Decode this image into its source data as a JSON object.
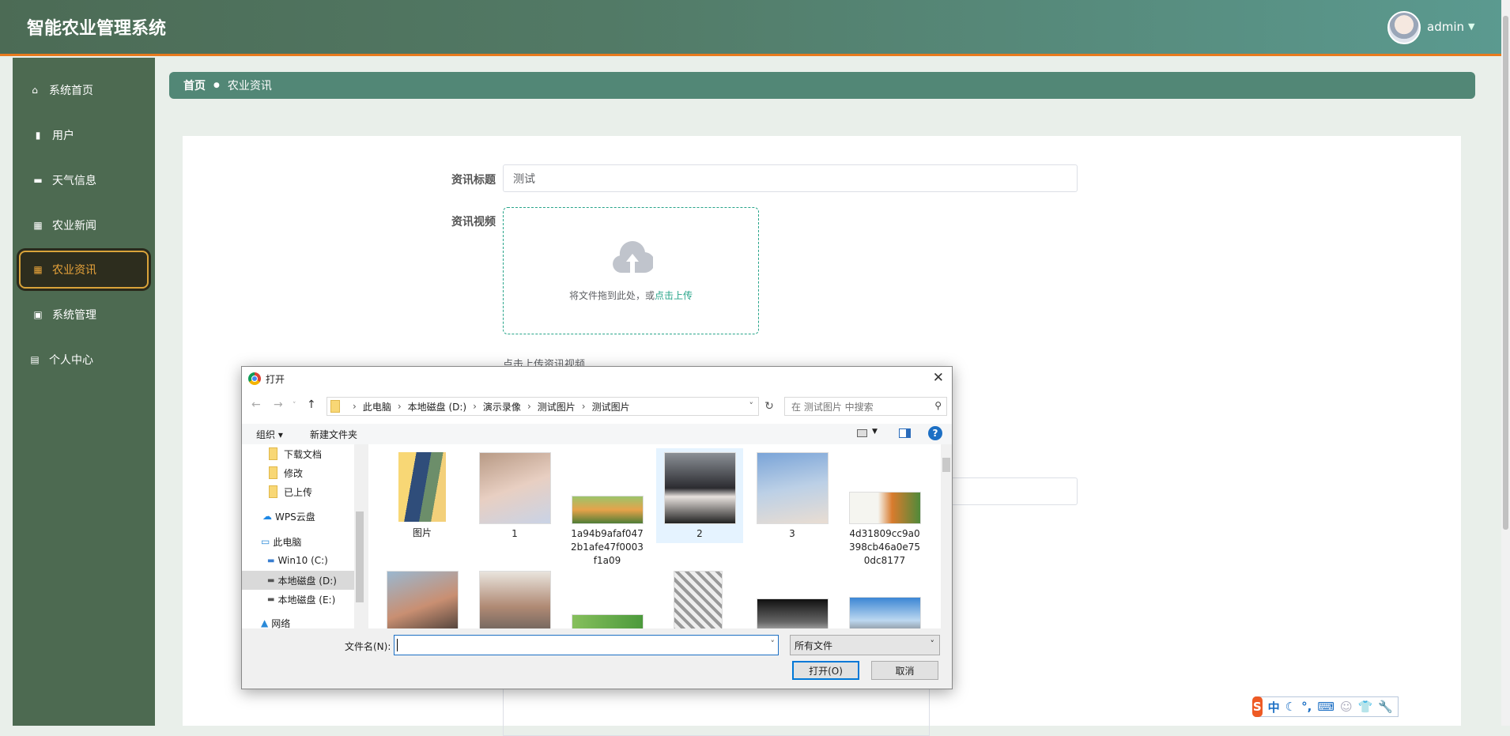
{
  "header": {
    "title": "智能农业管理系统",
    "user": "admin"
  },
  "sidebar": {
    "items": [
      {
        "label": "系统首页",
        "icon": "home-icon",
        "glyph": "⌂"
      },
      {
        "label": "用户",
        "icon": "bar-chart-icon",
        "glyph": "▮"
      },
      {
        "label": "天气信息",
        "icon": "ticket-icon",
        "glyph": "▬"
      },
      {
        "label": "农业新闻",
        "icon": "grid-icon",
        "glyph": "▦"
      },
      {
        "label": "农业资讯",
        "icon": "grid-icon",
        "glyph": "▦",
        "active": true
      },
      {
        "label": "系统管理",
        "icon": "clipboard-icon",
        "glyph": "▣"
      },
      {
        "label": "个人中心",
        "icon": "calendar-icon",
        "glyph": "▤"
      }
    ]
  },
  "breadcrumb": {
    "home": "首页",
    "current": "农业资讯"
  },
  "form": {
    "title_label": "资讯标题",
    "title_value": "测试",
    "video_label": "资讯视频",
    "upload_hint": "将文件拖到此处，或",
    "upload_link": "点击上传",
    "upload_caption": "点击上传资讯视频"
  },
  "dialog": {
    "title": "打开",
    "path": [
      "此电脑",
      "本地磁盘 (D:)",
      "演示录像",
      "测试图片",
      "测试图片"
    ],
    "search_placeholder": "在 测试图片 中搜索",
    "organize": "组织 ▾",
    "new_folder": "新建文件夹",
    "nav": [
      "下载文档",
      "修改",
      "已上传",
      "WPS云盘",
      "此电脑",
      "Win10 (C:)",
      "本地磁盘 (D:)",
      "本地磁盘 (E:)",
      "网络"
    ],
    "nav_selected": "本地磁盘 (D:)",
    "files": [
      "图片",
      "1",
      "1a94b9afaf0472b1afe47f0003f1a09",
      "2",
      "3",
      "4d31809cc9a0398cb46a0e750dc8177"
    ],
    "selected_file": "2",
    "filename_label": "文件名(N):",
    "filename_value": "",
    "filetype": "所有文件",
    "open_button": "打开(O)",
    "cancel_button": "取消"
  },
  "ime": {
    "logo": "S",
    "mode": "中"
  },
  "colors": {
    "header": "#4c6b55",
    "accent_orange": "#e87a1e",
    "sidebar": "#4d6a51",
    "active_gold": "#d9a33a",
    "breadcrumb": "#528776",
    "link_green": "#28a58a"
  }
}
